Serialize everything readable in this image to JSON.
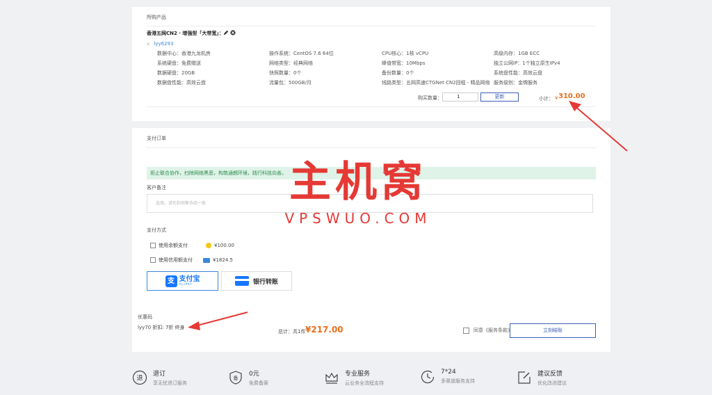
{
  "purchased": {
    "title": "所购产品",
    "product_name": "香港五网CN2 · 增强型「大带宽」：",
    "username": "lyy6293",
    "specs": [
      [
        "数据中心：香港九龙机房",
        "操作系统：CentOS 7.6 64位",
        "CPU核心：1核 vCPU",
        "高级内存：1GB ECC"
      ],
      [
        "系统硬盘：免费赠送",
        "网络类型：经典网络",
        "峰值带宽：10Mbps",
        "独立公网IP：1个独立原生IPv4"
      ],
      [
        "数据硬盘：20GB",
        "快照数量：0个",
        "备份数量：0个",
        "系统盘性能：高效云盘"
      ],
      [
        "数据盘性能：高效云盘",
        "流量包：500GB/月",
        "线路类型：五网高速CTGNet CN2回程 - 精品网络",
        "服务级别：金牌服务"
      ]
    ],
    "qty_label": "购买数量：",
    "qty_value": "1",
    "update_label": "更新",
    "subtotal_label": "小计：",
    "subtotal_currency": "¥",
    "subtotal_value": "310.00"
  },
  "pay": {
    "title": "支付订单",
    "notice": "拒止联合协作，扫除网络黑恶，构筑通朗环境，践行科技向善。",
    "remark_label": "客户备注",
    "remark_placeholder": "选填，请先和销售协商一致",
    "method_label": "支付方式",
    "balance_label": "使用余额支付",
    "balance_amount": "¥100.00",
    "credit_label": "使用信用额支付",
    "credit_amount": "¥1824.5",
    "alipay_cn": "支付宝",
    "alipay_en": "ALIPAY",
    "alipay_mark": "支",
    "bank_label": "银行转账",
    "coupon_label": "优惠码",
    "coupon_value": "lyy70 折扣: 7折 终身",
    "total_label": "总计：共1件",
    "total_value": "¥217.00",
    "agree_label": "同意《服务条款》",
    "paynow_label": "立刻结账"
  },
  "footer": [
    {
      "title": "退订",
      "sub": "享无忧退订服务",
      "icon": "refund-icon",
      "glyph": "退"
    },
    {
      "title": "0元",
      "sub": "免费备案",
      "icon": "shield-icon",
      "glyph": "备"
    },
    {
      "title": "专业服务",
      "sub": "云业务全流程支持",
      "icon": "crown-icon",
      "glyph": ""
    },
    {
      "title": "7*24",
      "sub": "多渠道服务支持",
      "icon": "clock-icon",
      "glyph": ""
    },
    {
      "title": "建议反馈",
      "sub": "优化改进建议",
      "icon": "edit-icon",
      "glyph": ""
    }
  ],
  "watermark": {
    "cn": "主机窝",
    "en": "VPSWUO.COM"
  },
  "colors": {
    "accent": "#3b5eb5",
    "price": "#e76f1a",
    "link": "#3b86d8",
    "notice_bg": "#dff3e8",
    "watermark": "#e53935"
  }
}
